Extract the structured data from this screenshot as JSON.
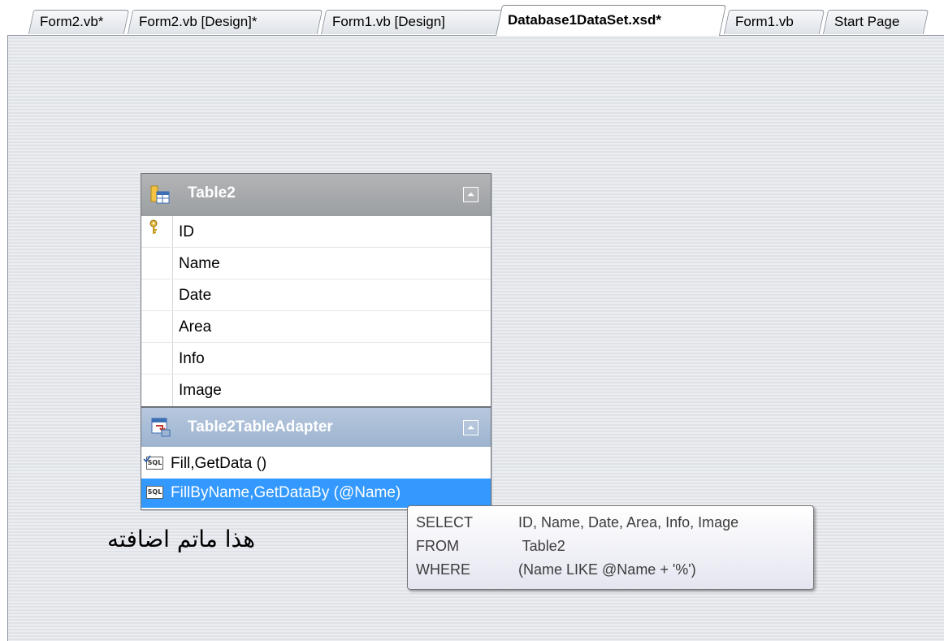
{
  "tabs": [
    {
      "label": "Form2.vb*",
      "active": false
    },
    {
      "label": "Form2.vb [Design]*",
      "active": false
    },
    {
      "label": "Form1.vb [Design]",
      "active": false
    },
    {
      "label": "Database1DataSet.xsd*",
      "active": true
    },
    {
      "label": "Form1.vb",
      "active": false
    },
    {
      "label": "Start Page",
      "active": false
    }
  ],
  "table": {
    "name": "Table2",
    "icon": "table-icon",
    "collapse_icon": "chevron-double-up-icon",
    "columns": [
      {
        "name": "ID",
        "primary_key": true
      },
      {
        "name": "Name"
      },
      {
        "name": "Date"
      },
      {
        "name": "Area"
      },
      {
        "name": "Info"
      },
      {
        "name": "Image"
      }
    ],
    "key_icon": "primary-key-icon"
  },
  "adapter": {
    "name": "Table2TableAdapter",
    "icon": "table-adapter-icon",
    "methods": [
      {
        "label": "Fill,GetData ()",
        "icon": "sql-icon",
        "selected": false
      },
      {
        "label": "FillByName,GetDataBy (@Name)",
        "icon": "sql-icon",
        "selected": true
      }
    ]
  },
  "tooltip": {
    "lines": [
      {
        "keyword": "SELECT",
        "value": "ID, Name, Date, Area, Info, Image"
      },
      {
        "keyword": "FROM",
        "value": " Table2"
      },
      {
        "keyword": "WHERE",
        "value": "(Name LIKE @Name + '%')"
      }
    ]
  },
  "note": "هذا ماتم اضافته",
  "colors": {
    "selection": "#3399ff",
    "table_header": "#9fa2a5",
    "adapter_header": "#a9bcd6"
  }
}
